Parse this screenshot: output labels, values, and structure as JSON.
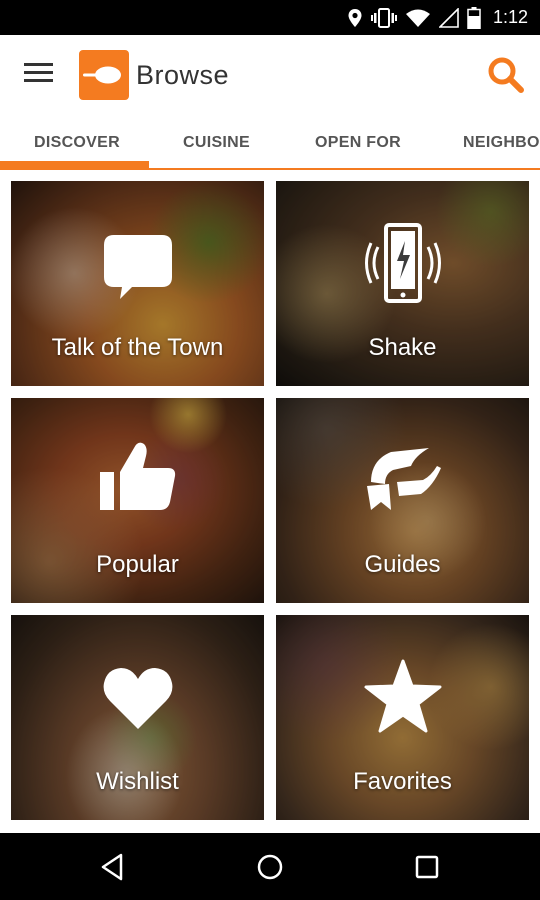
{
  "status_bar": {
    "time": "1:12",
    "icons": [
      "location-icon",
      "vibrate-icon",
      "wifi-icon",
      "signal-icon",
      "battery-icon"
    ]
  },
  "app_bar": {
    "title": "Browse",
    "logo_icon": "opentable-logo-icon",
    "menu_icon": "hamburger-menu-icon",
    "search_icon": "search-icon"
  },
  "tabs": [
    {
      "label": "DISCOVER",
      "selected": true
    },
    {
      "label": "CUISINE",
      "selected": false
    },
    {
      "label": "OPEN FOR",
      "selected": false
    },
    {
      "label": "NEIGHBOR",
      "selected": false
    }
  ],
  "tiles": [
    {
      "label": "Talk of the Town",
      "icon": "speech-bubble-icon"
    },
    {
      "label": "Shake",
      "icon": "phone-shake-icon"
    },
    {
      "label": "Popular",
      "icon": "thumbs-up-icon"
    },
    {
      "label": "Guides",
      "icon": "guide-map-icon"
    },
    {
      "label": "Wishlist",
      "icon": "heart-icon"
    },
    {
      "label": "Favorites",
      "icon": "star-icon"
    }
  ],
  "nav_bar": {
    "icons": [
      "back-icon",
      "home-icon",
      "recents-icon"
    ]
  },
  "colors": {
    "accent": "#f47b20",
    "status_bar": "#000000",
    "nav_bar": "#000000"
  }
}
